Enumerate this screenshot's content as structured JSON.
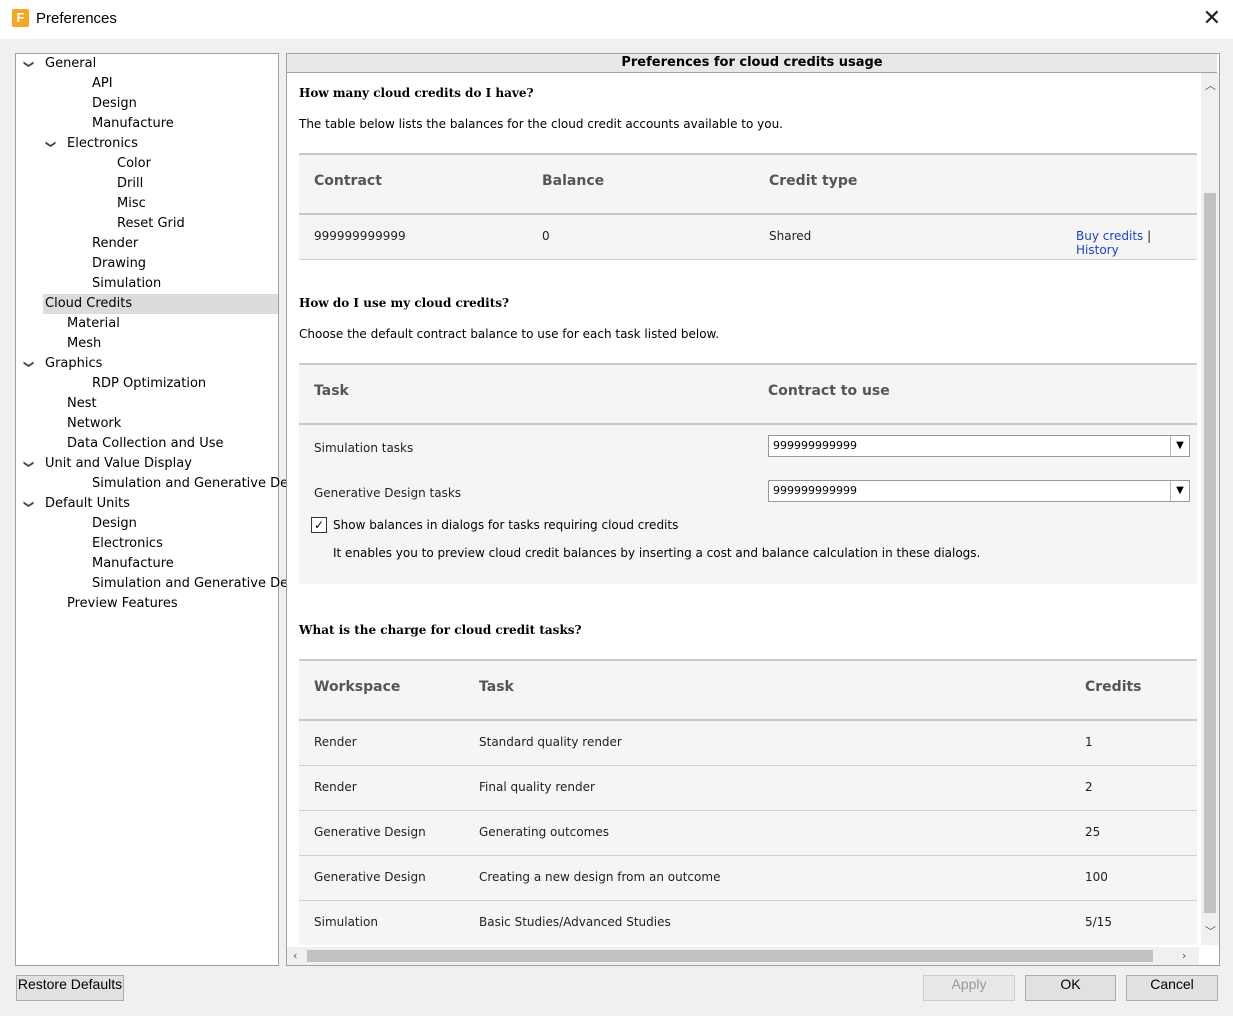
{
  "window": {
    "title": "Preferences",
    "icon_letter": "F"
  },
  "tree": [
    {
      "label": "General",
      "indent": 0,
      "expander": "v"
    },
    {
      "label": "API",
      "indent": 2
    },
    {
      "label": "Design",
      "indent": 2
    },
    {
      "label": "Manufacture",
      "indent": 2
    },
    {
      "label": "Electronics",
      "indent": 1,
      "expander": "v"
    },
    {
      "label": "Color",
      "indent": 3
    },
    {
      "label": "Drill",
      "indent": 3
    },
    {
      "label": "Misc",
      "indent": 3
    },
    {
      "label": "Reset Grid",
      "indent": 3
    },
    {
      "label": "Render",
      "indent": 2
    },
    {
      "label": "Drawing",
      "indent": 2
    },
    {
      "label": "Simulation",
      "indent": 2
    },
    {
      "label": "Cloud Credits",
      "indent": 1,
      "selected": true
    },
    {
      "label": "Material",
      "indent": 1
    },
    {
      "label": "Mesh",
      "indent": 1
    },
    {
      "label": "Graphics",
      "indent": 0,
      "expander": "v"
    },
    {
      "label": "RDP Optimization",
      "indent": 2
    },
    {
      "label": "Nest",
      "indent": 1
    },
    {
      "label": "Network",
      "indent": 1
    },
    {
      "label": "Data Collection and Use",
      "indent": 1
    },
    {
      "label": "Unit and Value Display",
      "indent": 0,
      "expander": "v"
    },
    {
      "label": "Simulation and Generative Design",
      "indent": 2
    },
    {
      "label": "Default Units",
      "indent": 0,
      "expander": "v"
    },
    {
      "label": "Design",
      "indent": 2
    },
    {
      "label": "Electronics",
      "indent": 2
    },
    {
      "label": "Manufacture",
      "indent": 2
    },
    {
      "label": "Simulation and Generative Design",
      "indent": 2
    },
    {
      "label": "Preview Features",
      "indent": 1
    }
  ],
  "panel": {
    "header": "Preferences for cloud credits usage",
    "section1": {
      "heading": "How many cloud credits do I have?",
      "desc": "The table below lists the balances for the cloud credit accounts available to you.",
      "columns": [
        "Contract",
        "Balance",
        "Credit type"
      ],
      "row": {
        "contract": "999999999999",
        "balance": "0",
        "type": "Shared"
      },
      "buy_link": "Buy credits",
      "separator": "|",
      "history_link": "History"
    },
    "section2": {
      "heading": "How do I use my cloud credits?",
      "desc": "Choose the default contract balance to use for each task listed below.",
      "columns": [
        "Task",
        "Contract to use"
      ],
      "rows": [
        {
          "task": "Simulation tasks",
          "value": "999999999999"
        },
        {
          "task": "Generative Design tasks",
          "value": "999999999999"
        }
      ],
      "checkbox_label": "Show balances in dialogs for tasks requiring cloud credits",
      "checkbox_checked": true,
      "checkbox_note": "It enables you to preview cloud credit balances by inserting a cost and balance calculation in these dialogs."
    },
    "section3": {
      "heading": "What is the charge for cloud credit tasks?",
      "columns": [
        "Workspace",
        "Task",
        "Credits"
      ],
      "rows": [
        {
          "workspace": "Render",
          "task": "Standard quality render",
          "credits": "1"
        },
        {
          "workspace": "Render",
          "task": "Final quality render",
          "credits": "2"
        },
        {
          "workspace": "Generative Design",
          "task": "Generating outcomes",
          "credits": "25"
        },
        {
          "workspace": "Generative Design",
          "task": "Creating a new design from an outcome",
          "credits": "100"
        },
        {
          "workspace": "Simulation",
          "task": "Basic Studies/Advanced Studies",
          "credits": "5/15"
        }
      ]
    }
  },
  "buttons": {
    "restore": "Restore Defaults",
    "apply": "Apply",
    "ok": "OK",
    "cancel": "Cancel"
  },
  "colors": {
    "link": "#1a44c8",
    "selected_row": "#dcdcdc"
  }
}
